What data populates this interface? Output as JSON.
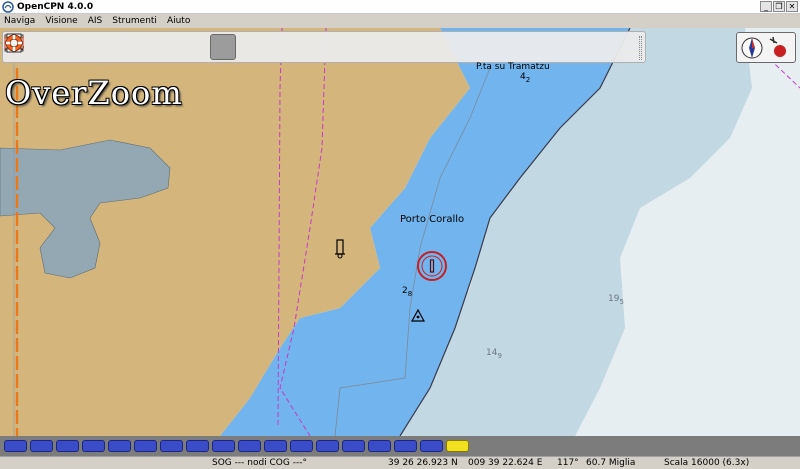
{
  "window": {
    "title": "OpenCPN 4.0.0",
    "controls": {
      "minimize": "_",
      "restore": "❐",
      "close": "✕"
    }
  },
  "menu": {
    "items": [
      "Naviga",
      "Visione",
      "AIS",
      "Strumenti",
      "Aiuto"
    ]
  },
  "toolbar": {
    "tools": [
      "zoom-in-icon",
      "zoom-out-icon",
      "scale-in-icon",
      "scale-out-icon",
      "route-icon",
      "ship-icon",
      "settings-wrench-icon",
      "text-toggle-icon",
      "measure-icon",
      "chart-quilt-icon",
      "tide-current-icon",
      "print-icon",
      "ais-icon",
      "track-icon",
      "color-scheme-icon",
      "help-book-icon",
      "mob-icon",
      "route-manager-icon",
      "notes-icon",
      "lifebuoy-icon"
    ],
    "active_tool": "text-toggle-icon"
  },
  "chart": {
    "overzoom_label": "OverZoom",
    "place_top": "P.ta su Tramatzu",
    "place_main": "Porto Corallo",
    "depths": [
      {
        "main": "4",
        "sub": "2"
      },
      {
        "main": "2",
        "sub": "8"
      },
      {
        "main": "19",
        "sub": "5"
      },
      {
        "main": "14",
        "sub": "9"
      }
    ],
    "colors": {
      "land": "#d4b67c",
      "shallow_water": "#72b4ee",
      "medium_water": "#c2d8e2",
      "deep_water": "#e6eef2",
      "lake": "#94a8b4",
      "limit_line": "#c838c8"
    }
  },
  "piano": {
    "key_count": 18,
    "selected_index": 17,
    "colors": {
      "key": "#3a4cc8",
      "selected": "#f0e020"
    }
  },
  "status": {
    "sog_cog": "SOG --- nodi COG ---°",
    "latitude": "39 26 26.923 N",
    "longitude": "009 39 22.624 E",
    "bearing": "117°",
    "distance": "60.7 Miglia",
    "scale": "Scala 16000 (6.3x)"
  }
}
